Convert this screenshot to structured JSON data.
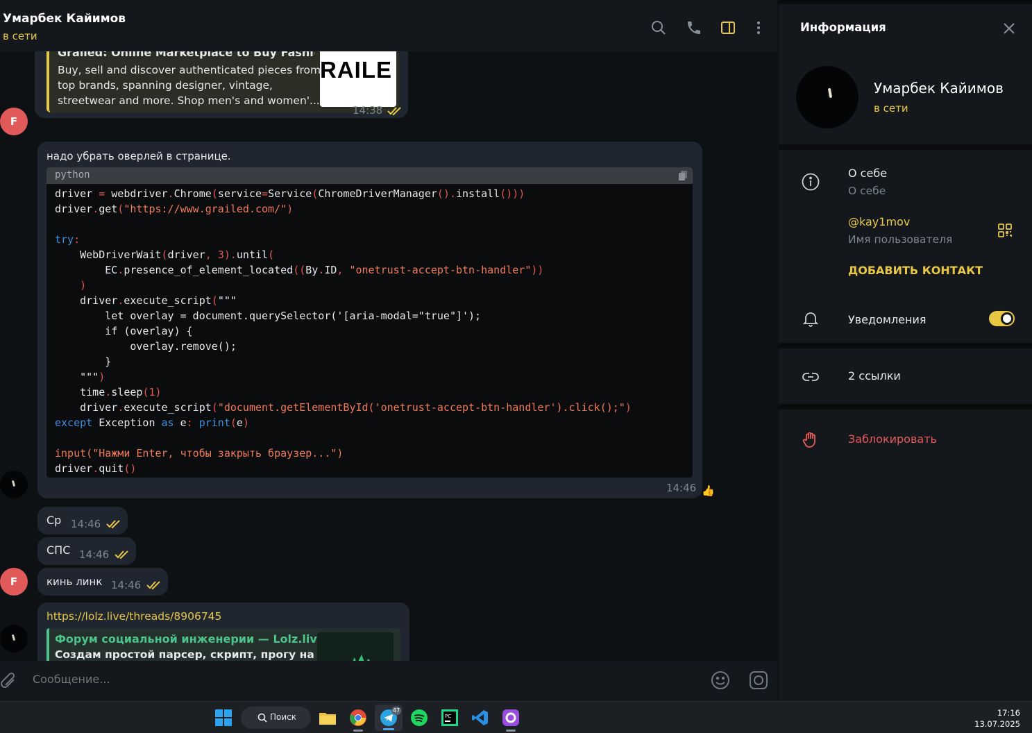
{
  "chat": {
    "title": "Умарбек Кайимов",
    "status": "в сети",
    "composer_placeholder": "Сообщение..."
  },
  "messages": {
    "preview1": {
      "title": "Grailed: Online Marketplace to Buy Fashion",
      "desc": "Buy, sell and discover authenticated pieces from top brands, spanning designer, vintage, streetwear and more. Shop men's and women'...",
      "image_text": "RAILE",
      "time": "14:38",
      "avatar": "F"
    },
    "code_msg": {
      "text": "надо убрать оверлей в странице.",
      "lang": "python",
      "time": "14:46",
      "reaction": "👍"
    },
    "short1": {
      "text": "Ср",
      "time": "14:46"
    },
    "short2": {
      "text": "СПС",
      "time": "14:46"
    },
    "short3": {
      "text": "кинь линк",
      "time": "14:46",
      "avatar": "F"
    },
    "link_msg": {
      "url": "https://lolz.live/threads/8906745",
      "preview_title": "Форум социальной инженерии — Lolz.live (...",
      "preview_desc": "Создам простой парсер, скрипт, прогу на"
    }
  },
  "code_lines": {
    "l1a": "driver",
    "l1b": " = ",
    "l1c": "webdriver",
    "l1d": ".",
    "l1e": "Chrome",
    "l1f": "(",
    "l1g": "service",
    "l1h": "=",
    "l1i": "Service",
    "l1j": "(",
    "l1k": "ChromeDriverManager",
    "l1l": "()",
    "l1m": ".",
    "l1n": "install",
    "l1o": "()))",
    "l2a": "driver",
    "l2b": ".",
    "l2c": "get",
    "l2d": "(",
    "l2e": "\"https://www.grailed.com/\"",
    "l2f": ")",
    "l4a": "try",
    "l4b": ":",
    "l5a": "    WebDriverWait",
    "l5b": "(",
    "l5c": "driver",
    "l5d": ", ",
    "l5e": "3",
    "l5f": ")",
    "l5g": ".",
    "l5h": "until",
    "l5i": "(",
    "l6a": "        EC",
    "l6b": ".",
    "l6c": "presence_of_element_located",
    "l6d": "((",
    "l6e": "By",
    "l6f": ".",
    "l6g": "ID",
    "l6h": ", ",
    "l6i": "\"onetrust-accept-btn-handler\"",
    "l6j": "))",
    "l7a": "    )",
    "l8a": "    driver",
    "l8b": ".",
    "l8c": "execute_script",
    "l8d": "(",
    "l8e": "\"\"\"",
    "l9a": "        let overlay = document.querySelector('[aria-modal=\"true\"]');",
    "l10a": "        if (overlay) {",
    "l11a": "            overlay.remove();",
    "l12a": "        }",
    "l13a": "    \"\"\"",
    "l13b": ")",
    "l14a": "    time",
    "l14b": ".",
    "l14c": "sleep",
    "l14d": "(",
    "l14e": "1",
    "l14f": ")",
    "l15a": "    driver",
    "l15b": ".",
    "l15c": "execute_script",
    "l15d": "(",
    "l15e": "\"document.getElementById('onetrust-accept-btn-handler').click();\"",
    "l15f": ")",
    "l16a": "except",
    "l16b": " Exception ",
    "l16c": "as",
    "l16d": " e",
    "l16e": ": ",
    "l16f": "print",
    "l16g": "(",
    "l16h": "e",
    "l16i": ")",
    "l18a": "input",
    "l18b": "(",
    "l18c": "\"Нажми Enter, чтобы закрыть браузер...\"",
    "l18d": ")",
    "l19a": "driver",
    "l19b": ".",
    "l19c": "quit",
    "l19d": "()"
  },
  "info": {
    "title": "Информация",
    "name": "Умарбек Кайимов",
    "status": "в сети",
    "about_label": "О себе",
    "about_sub": "О себе",
    "username": "@kay1mov",
    "username_sub": "Имя пользователя",
    "add_contact": "ДОБАВИТЬ КОНТАКТ",
    "notifications": "Уведомления",
    "notifications_on": true,
    "links": "2 ссылки",
    "block": "Заблокировать"
  },
  "taskbar": {
    "search": "Поиск",
    "time": "17:16",
    "date": "13.07.2025",
    "telegram_badge": "47"
  },
  "colors": {
    "accent": "#e8c843",
    "danger": "#e85a5a",
    "link_green": "#4cc38a"
  }
}
